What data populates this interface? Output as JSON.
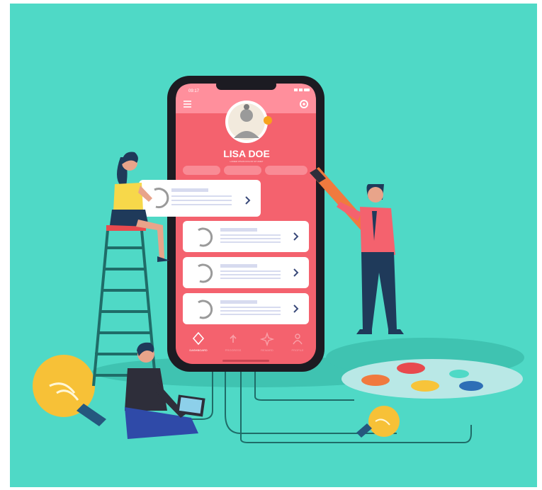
{
  "profile": {
    "name": "LISA DOE",
    "tagline": "LOREM IPSUM DOLOR SIT AMET"
  },
  "status_bar": {
    "time": "09:17"
  },
  "nav": {
    "items": [
      {
        "label": "DASHBOARD",
        "icon": "diamond-icon",
        "active": true
      },
      {
        "label": "PROGRESS",
        "icon": "arrow-up-icon",
        "active": false
      },
      {
        "label": "REWARD",
        "icon": "sparkle-icon",
        "active": false
      },
      {
        "label": "PROFILE",
        "icon": "person-icon",
        "active": false
      }
    ]
  },
  "cards": [
    {
      "progress": 0.7,
      "icon": "progress-ring-icon"
    },
    {
      "progress": 0.6,
      "icon": "progress-ring-icon"
    },
    {
      "progress": 0.8,
      "icon": "progress-ring-icon"
    },
    {
      "progress": 0.55,
      "icon": "progress-ring-icon"
    }
  ],
  "colors": {
    "background": "#4fd9c6",
    "screen_top": "#ff8f9c",
    "screen": "#f4626e",
    "phone_frame": "#1c1b22",
    "card": "#ffffff",
    "chevron": "#3a4a7a",
    "bulb": "#f7c137"
  }
}
